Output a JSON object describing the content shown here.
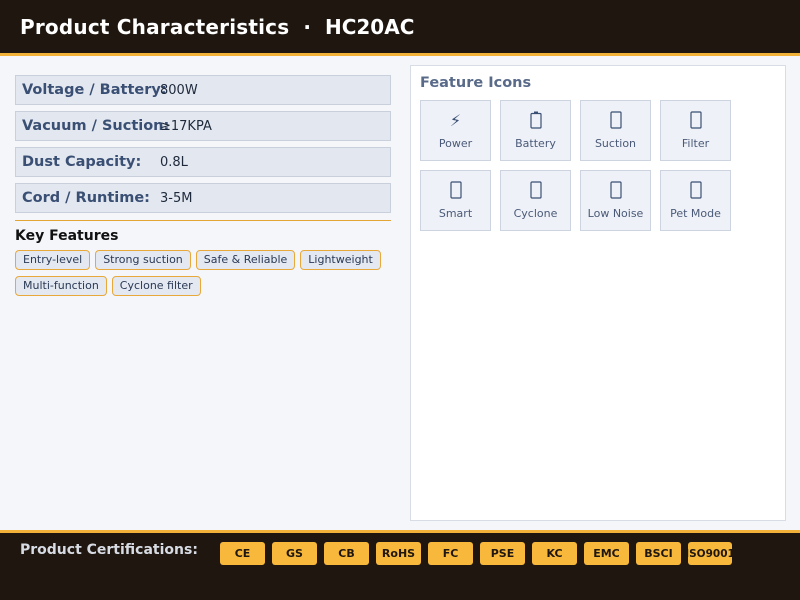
{
  "header": {
    "title": "Product Characteristics",
    "separator": "·",
    "model": "HC20AC"
  },
  "specs": [
    {
      "label": "Voltage / Battery:",
      "value": "800W"
    },
    {
      "label": "Vacuum / Suction:",
      "value": "≥17KPA"
    },
    {
      "label": "Dust Capacity:",
      "value": "0.8L"
    },
    {
      "label": "Cord / Runtime:",
      "value": "3-5M"
    }
  ],
  "key_features": {
    "title": "Key Features",
    "tags": [
      "Entry-level",
      "Strong suction",
      "Safe & Reliable",
      "Lightweight",
      "Multi-function",
      "Cyclone filter"
    ]
  },
  "feature_icons": {
    "title": "Feature Icons",
    "items": [
      {
        "icon": "lightning-icon",
        "label": "Power"
      },
      {
        "icon": "battery-icon",
        "label": "Battery"
      },
      {
        "icon": "suction-icon",
        "label": "Suction"
      },
      {
        "icon": "filter-icon",
        "label": "Filter"
      },
      {
        "icon": "smart-icon",
        "label": "Smart"
      },
      {
        "icon": "cyclone-icon",
        "label": "Cyclone"
      },
      {
        "icon": "low-noise-icon",
        "label": "Low Noise"
      },
      {
        "icon": "pet-mode-icon",
        "label": "Pet Mode"
      }
    ]
  },
  "footer": {
    "label": "Product Certifications:",
    "certs": [
      "CE",
      "GS",
      "CB",
      "RoHS",
      "FC",
      "PSE",
      "KC",
      "EMC",
      "BSCI",
      "ISO9001"
    ]
  },
  "colors": {
    "header_bg": "#1f170f",
    "accent": "#f2b23a",
    "cert_badge": "#f8b83c",
    "label_blue": "#3a4f74"
  }
}
